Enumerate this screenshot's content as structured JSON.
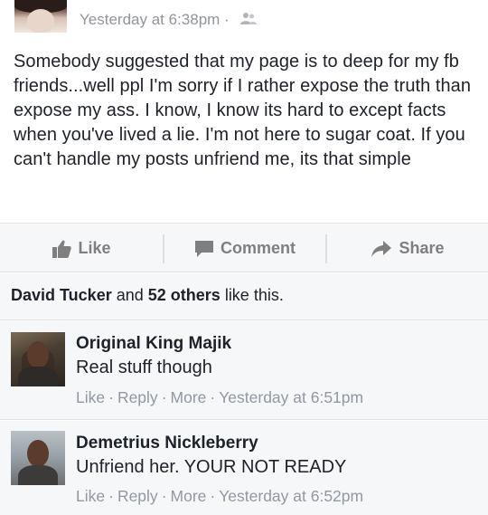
{
  "post": {
    "timestamp": "Yesterday at 6:38pm",
    "dot": "·",
    "privacy_icon": "friends-icon",
    "text": "Somebody suggested that my page is to deep for my fb friends...well ppl I'm sorry if I rather expose the truth than expose my ass. I know, I know its hard to except facts when you've lived a lie. I'm not here to sugar coat. If you can't handle my posts unfriend me, its that simple"
  },
  "actions": {
    "like": "Like",
    "comment": "Comment",
    "share": "Share"
  },
  "likes": {
    "first_name": "David Tucker",
    "and": " and ",
    "others": "52 others",
    "suffix": " like this."
  },
  "comments": [
    {
      "author": "Original King Majik",
      "text": "Real stuff though",
      "like": "Like",
      "reply": "Reply",
      "more": "More",
      "time": "Yesterday at 6:51pm"
    },
    {
      "author": "Demetrius Nickleberry",
      "text": "Unfriend her. YOUR NOT READY",
      "like": "Like",
      "reply": "Reply",
      "more": "More",
      "time": "Yesterday at 6:52pm"
    }
  ],
  "colors": {
    "meta_gray": "#90949c",
    "action_gray": "#7f7f7f",
    "bar_bg": "#f6f7f9"
  }
}
